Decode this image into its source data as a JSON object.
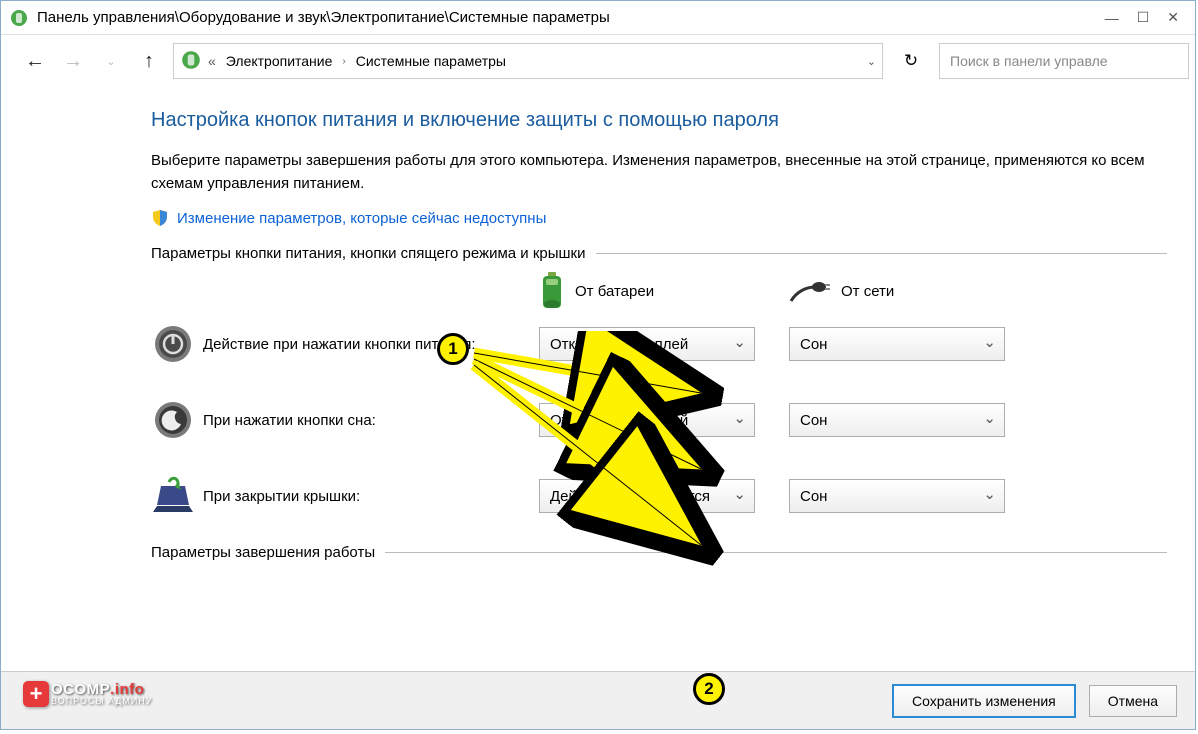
{
  "window": {
    "title": "Панель управления\\Оборудование и звук\\Электропитание\\Системные параметры"
  },
  "breadcrumb": {
    "item1": "Электропитание",
    "item2": "Системные параметры"
  },
  "search": {
    "placeholder": "Поиск в панели управле"
  },
  "page": {
    "heading": "Настройка кнопок питания и включение защиты с помощью пароля",
    "description": "Выберите параметры завершения работы для этого компьютера. Изменения параметров, внесенные на этой странице, применяются ко всем схемам управления питанием.",
    "shieldLink": "Изменение параметров, которые сейчас недоступны",
    "section1": "Параметры кнопки питания, кнопки спящего режима и крышки",
    "section2": "Параметры завершения работы",
    "colBattery": "От батареи",
    "colMains": "От сети",
    "rows": [
      {
        "label": "Действие при нажатии кнопки питания:",
        "battery": "Отключить дисплей",
        "mains": "Сон"
      },
      {
        "label": "При нажатии кнопки сна:",
        "battery": "Отключить дисплей",
        "mains": "Сон"
      },
      {
        "label": "При закрытии крышки:",
        "battery": "Действие не требуется",
        "mains": "Сон"
      }
    ],
    "saveBtn": "Сохранить изменения",
    "cancelBtn": "Отмена"
  },
  "annotations": {
    "marker1": "1",
    "marker2": "2"
  },
  "logo": {
    "line1a": "OCOMP",
    "line1b": ".info",
    "line2": "ВОПРОСЫ АДМИНУ"
  }
}
